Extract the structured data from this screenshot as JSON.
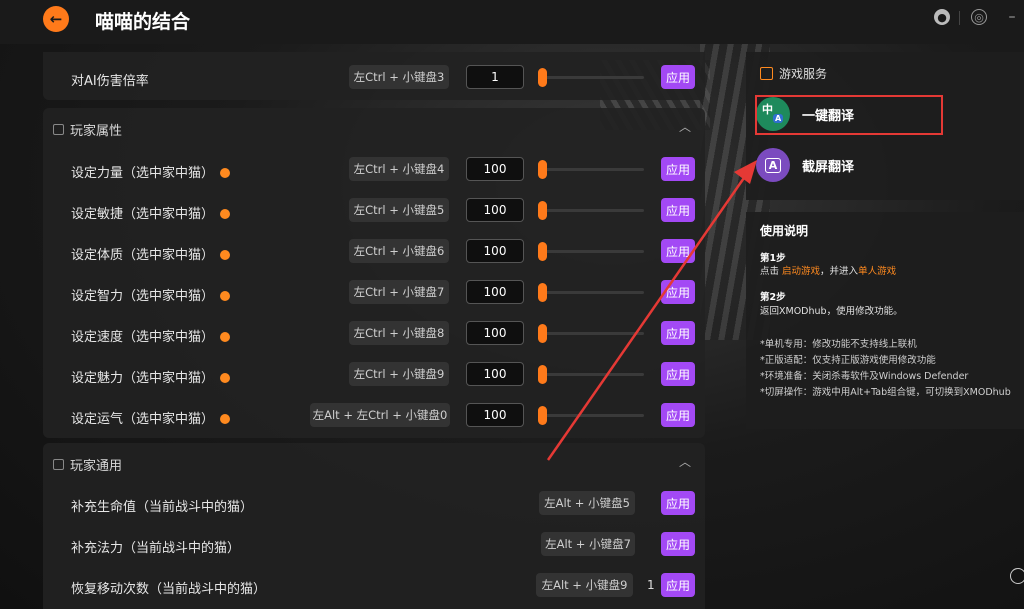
{
  "app": {
    "title": "喵喵的结合"
  },
  "top_panel": {
    "row": {
      "label": "对AI伤害倍率",
      "hotkey": "左Ctrl + 小键盘3",
      "value": "1",
      "apply": "应用"
    }
  },
  "player_attrs": {
    "title": "玩家属性",
    "rows": [
      {
        "label": "设定力量（选中家中猫）",
        "hotkey": "左Ctrl + 小键盘4",
        "value": "100",
        "apply": "应用"
      },
      {
        "label": "设定敏捷（选中家中猫）",
        "hotkey": "左Ctrl + 小键盘5",
        "value": "100",
        "apply": "应用"
      },
      {
        "label": "设定体质（选中家中猫）",
        "hotkey": "左Ctrl + 小键盘6",
        "value": "100",
        "apply": "应用"
      },
      {
        "label": "设定智力（选中家中猫）",
        "hotkey": "左Ctrl + 小键盘7",
        "value": "100",
        "apply": "应用"
      },
      {
        "label": "设定速度（选中家中猫）",
        "hotkey": "左Ctrl + 小键盘8",
        "value": "100",
        "apply": "应用"
      },
      {
        "label": "设定魅力（选中家中猫）",
        "hotkey": "左Ctrl + 小键盘9",
        "value": "100",
        "apply": "应用"
      },
      {
        "label": "设定运气（选中家中猫）",
        "hotkey": "左Alt + 左Ctrl + 小键盘0",
        "value": "100",
        "apply": "应用"
      }
    ]
  },
  "player_general": {
    "title": "玩家通用",
    "rows": [
      {
        "label": "补充生命值（当前战斗中的猫）",
        "hotkey": "左Alt + 小键盘5",
        "apply": "应用"
      },
      {
        "label": "补充法力（当前战斗中的猫）",
        "hotkey": "左Alt + 小键盘7",
        "apply": "应用"
      },
      {
        "label": "恢复移动次数（当前战斗中的猫）",
        "hotkey": "左Alt + 小键盘9",
        "count": "1",
        "apply": "应用"
      }
    ]
  },
  "services": {
    "title": "游戏服务",
    "items": [
      {
        "label": "一键翻译",
        "badge": "中",
        "badge_sub": "A",
        "color": "#1e8a5c"
      },
      {
        "label": "截屏翻译",
        "badge": "A",
        "color": "#7b4bbf"
      }
    ]
  },
  "usage": {
    "title": "使用说明",
    "step1_title": "第1步",
    "step1_pre": "点击 ",
    "step1_link1": "启动游戏",
    "step1_mid": "，并进入",
    "step1_link2": "单人游戏",
    "step2_title": "第2步",
    "step2_text": "返回XMODhub，使用修改功能。",
    "notes": [
      "*单机专用：修改功能不支持线上联机",
      "*正版适配：仅支持正版游戏使用修改功能",
      "*环境准备：关闭杀毒软件及Windows Defender",
      "*切屏操作：游戏中用Alt+Tab组合键，可切换到XMODhub"
    ]
  },
  "colors": {
    "accent": "#ff7a1a",
    "apply": "#a349f5",
    "annotation": "#e53935"
  }
}
